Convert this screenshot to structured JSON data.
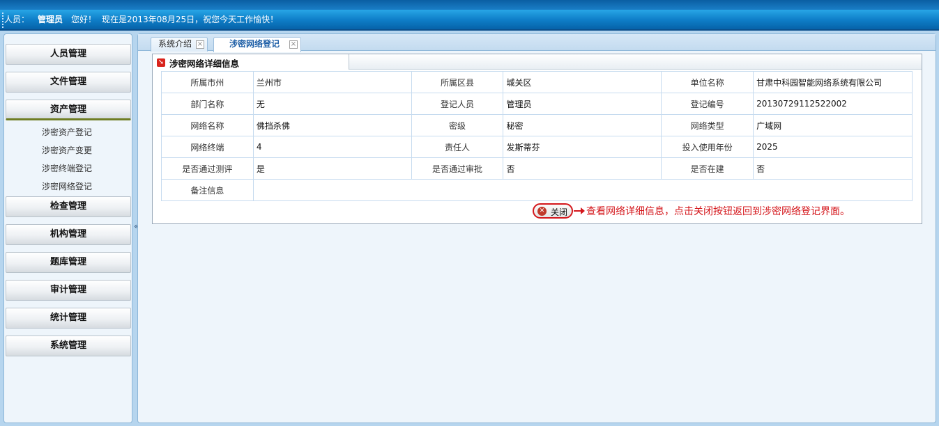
{
  "header": {
    "user_label": "人员：",
    "user_name": "管理员",
    "greeting": "您好！",
    "date_text": "现在是2013年08月25日，祝您今天工作愉快！"
  },
  "sidebar": {
    "menus": [
      {
        "label": "人员管理"
      },
      {
        "label": "文件管理"
      },
      {
        "label": "资产管理"
      },
      {
        "label": "检查管理"
      },
      {
        "label": "机构管理"
      },
      {
        "label": "题库管理"
      },
      {
        "label": "审计管理"
      },
      {
        "label": "统计管理"
      },
      {
        "label": "系统管理"
      }
    ],
    "submenu": [
      {
        "label": "涉密资产登记"
      },
      {
        "label": "涉密资产变更"
      },
      {
        "label": "涉密终端登记"
      },
      {
        "label": "涉密网络登记"
      }
    ],
    "collapse_icon": "«"
  },
  "tabs": [
    {
      "label": "系统介绍",
      "close": "×"
    },
    {
      "label": "涉密网络登记",
      "close": "×"
    }
  ],
  "panel": {
    "title": "涉密网络详细信息",
    "rows": [
      [
        {
          "label": "所属市州",
          "value": "兰州市"
        },
        {
          "label": "所属区县",
          "value": "城关区"
        },
        {
          "label": "单位名称",
          "value": "甘肃中科园智能网络系统有限公司"
        }
      ],
      [
        {
          "label": "部门名称",
          "value": "无"
        },
        {
          "label": "登记人员",
          "value": "管理员"
        },
        {
          "label": "登记编号",
          "value": "20130729112522002"
        }
      ],
      [
        {
          "label": "网络名称",
          "value": "佛挡杀佛"
        },
        {
          "label": "密级",
          "value": "秘密"
        },
        {
          "label": "网络类型",
          "value": "广域网"
        }
      ],
      [
        {
          "label": "网络终端",
          "value": "4"
        },
        {
          "label": "责任人",
          "value": "发斯蒂芬"
        },
        {
          "label": "投入使用年份",
          "value": "2025"
        }
      ],
      [
        {
          "label": "是否通过测评",
          "value": "是"
        },
        {
          "label": "是否通过审批",
          "value": "否"
        },
        {
          "label": "是否在建",
          "value": "否"
        }
      ]
    ],
    "remark_label": "备注信息",
    "remark_value": "",
    "close_label": "关闭",
    "hint": "查看网络详细信息，点击关闭按钮返回到涉密网络登记界面。"
  }
}
